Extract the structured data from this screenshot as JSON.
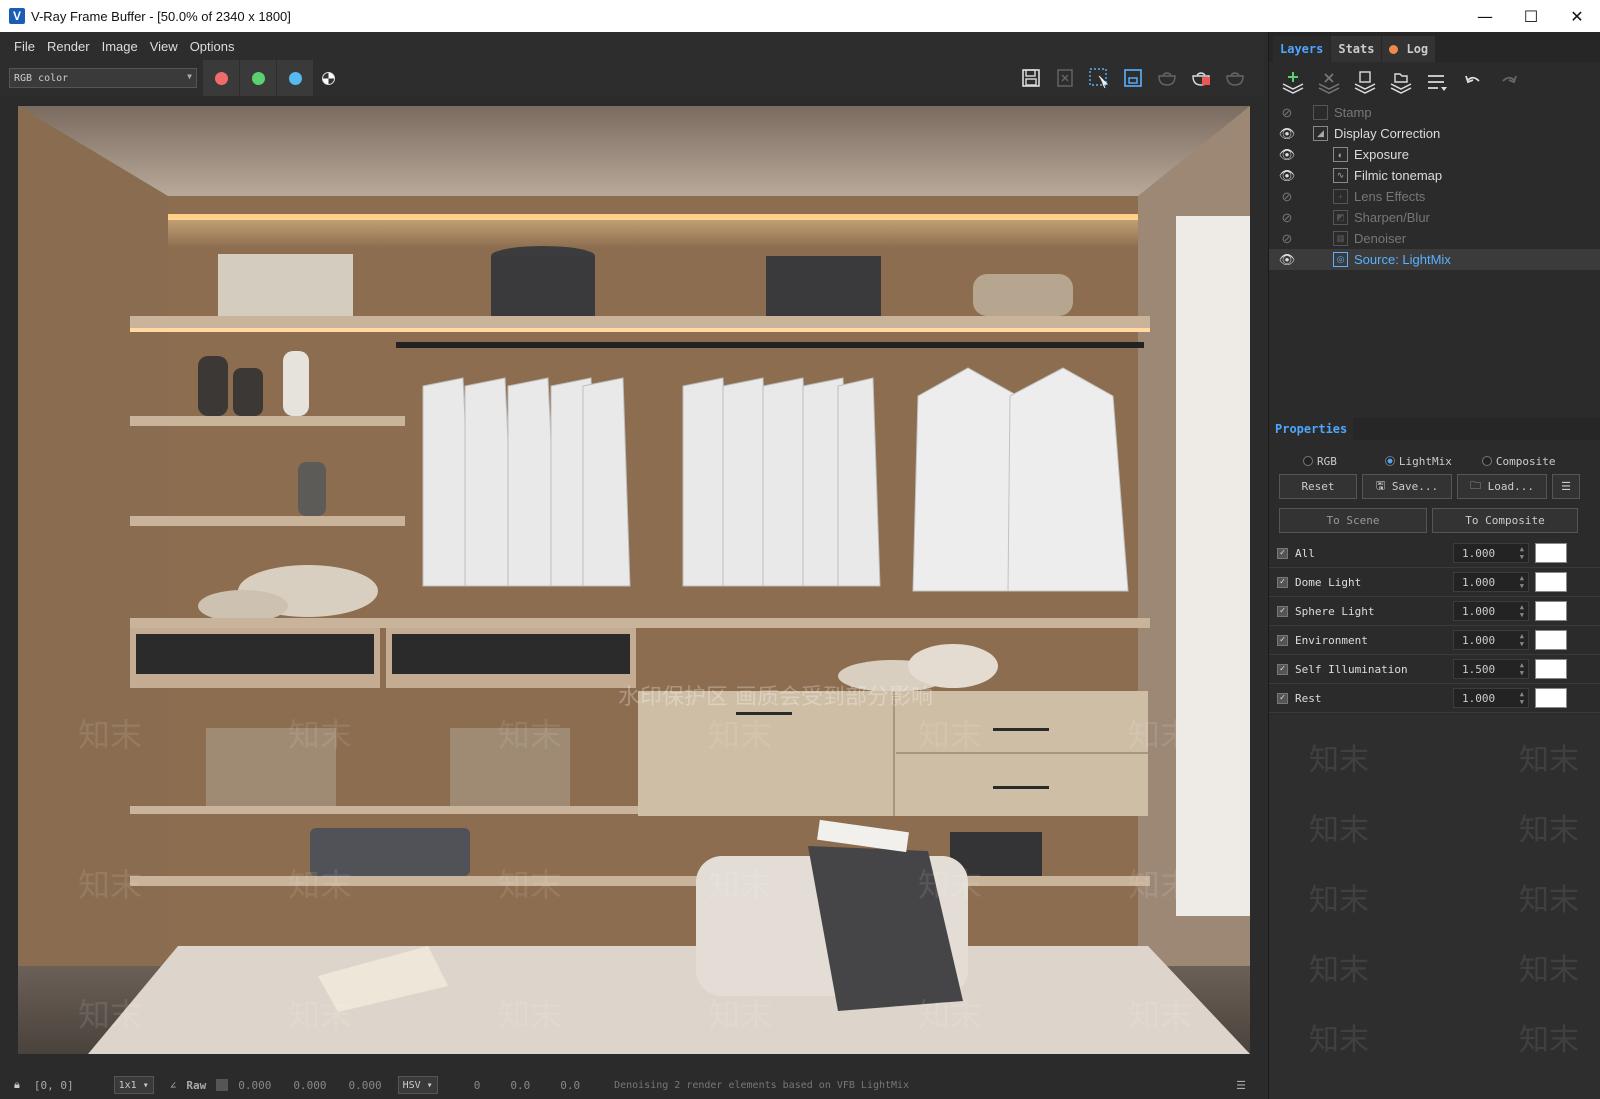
{
  "window": {
    "title": "V-Ray Frame Buffer - [50.0% of 2340 x 1800]",
    "controls": [
      "—",
      "☐",
      "✕"
    ]
  },
  "menu": [
    "File",
    "Render",
    "Image",
    "View",
    "Options"
  ],
  "toolbar": {
    "channel": "RGB color",
    "color_buttons": [
      "#f06b6b",
      "#5ccf6f",
      "#58b8f0"
    ]
  },
  "statusbar": {
    "coords": "[0, 0]",
    "zoom": "1x1",
    "raw_label": "Raw",
    "rgb": [
      "0.000",
      "0.000",
      "0.000"
    ],
    "color_mode": "HSV",
    "hsv": [
      "0",
      "0.0",
      "0.0"
    ],
    "message": "Denoising 2 render elements based on VFB LightMix"
  },
  "panel": {
    "tabs": [
      "Layers",
      "Stats",
      "Log"
    ],
    "layers": [
      {
        "name": "Stamp",
        "visible": false,
        "indent": 0,
        "state": "dim"
      },
      {
        "name": "Display Correction",
        "visible": true,
        "indent": 0,
        "state": "normal"
      },
      {
        "name": "Exposure",
        "visible": true,
        "indent": 1,
        "state": "normal"
      },
      {
        "name": "Filmic tonemap",
        "visible": true,
        "indent": 1,
        "state": "normal"
      },
      {
        "name": "Lens Effects",
        "visible": false,
        "indent": 1,
        "state": "dim"
      },
      {
        "name": "Sharpen/Blur",
        "visible": false,
        "indent": 1,
        "state": "dim"
      },
      {
        "name": "Denoiser",
        "visible": false,
        "indent": 1,
        "state": "dim"
      },
      {
        "name": "Source: LightMix",
        "visible": true,
        "indent": 1,
        "state": "selected"
      }
    ],
    "properties": {
      "header": "Properties",
      "modes": [
        "RGB",
        "LightMix",
        "Composite"
      ],
      "selected_mode": "LightMix",
      "reset": "Reset",
      "save": "Save...",
      "load": "Load...",
      "to_scene": "To Scene",
      "to_composite": "To Composite",
      "lights": [
        {
          "name": "All",
          "value": "1.000"
        },
        {
          "name": "Dome Light",
          "value": "1.000"
        },
        {
          "name": "Sphere Light",
          "value": "1.000"
        },
        {
          "name": "Environment",
          "value": "1.000"
        },
        {
          "name": "Self Illumination",
          "value": "1.500"
        },
        {
          "name": "Rest",
          "value": "1.000"
        }
      ]
    }
  },
  "watermark": {
    "caption": "水印保护区 画质会受到部分影响",
    "mark": "知末"
  }
}
